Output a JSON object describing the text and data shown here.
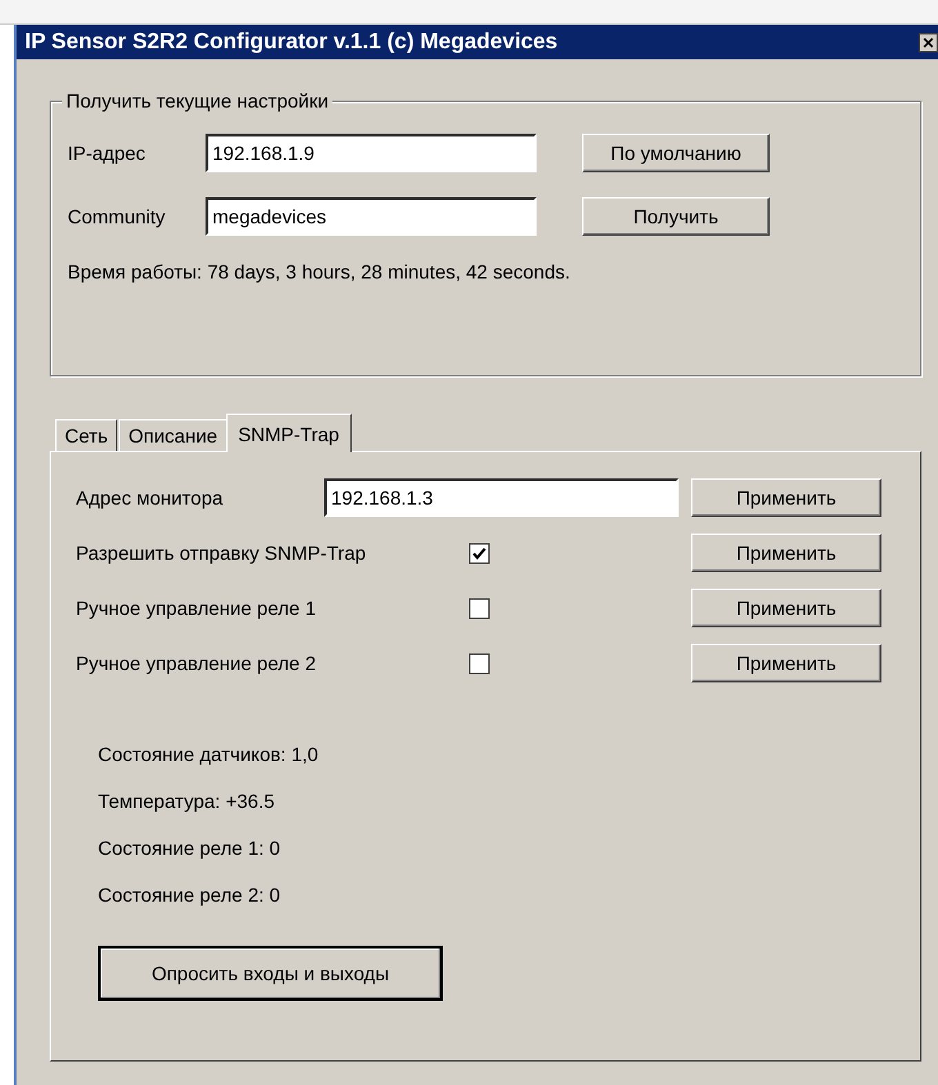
{
  "window": {
    "title": "IP Sensor S2R2 Configurator v.1.1 (c) Megadevices"
  },
  "settings_group": {
    "title": "Получить текущие настройки",
    "fields": [
      {
        "label": "IP-адрес",
        "value": "192.168.1.9",
        "button": "По умолчанию"
      },
      {
        "label": "Community",
        "value": "megadevices",
        "button": "Получить"
      }
    ],
    "uptime": "Время работы: 78 days, 3 hours, 28 minutes, 42 seconds."
  },
  "tabs": [
    {
      "label": "Сеть",
      "selected": false
    },
    {
      "label": "Описание",
      "selected": false
    },
    {
      "label": "SNMP-Trap",
      "selected": true
    }
  ],
  "trap_rows": [
    {
      "kind": "field",
      "label": "Адрес монитора",
      "value": "192.168.1.3",
      "button": "Применить"
    },
    {
      "kind": "checkbox",
      "label": "Разрешить отправку SNMP-Trap",
      "checked": true,
      "button": "Применить"
    },
    {
      "kind": "checkbox",
      "label": "Ручное управление реле 1",
      "checked": false,
      "button": "Применить"
    },
    {
      "kind": "checkbox",
      "label": "Ручное управление реле 2",
      "checked": false,
      "button": "Применить"
    }
  ],
  "status_lines": [
    "Состояние датчиков: 1,0",
    "Температура: +36.5",
    "Состояние реле 1: 0",
    "Состояние реле 2: 0"
  ],
  "poll_button": "Опросить входы и выходы"
}
